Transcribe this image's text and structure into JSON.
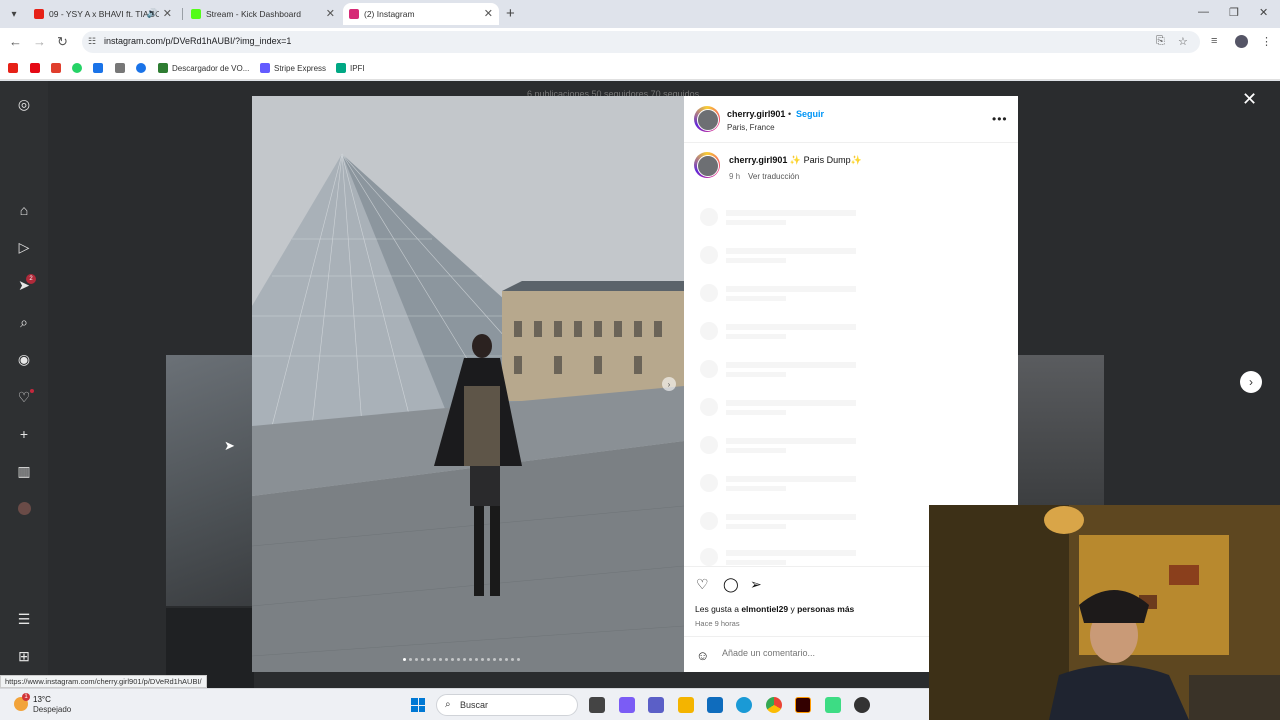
{
  "browser": {
    "tabs": [
      {
        "title": "09 - YSY A x BHAVI ft. TIAGO",
        "favicon_color": "#e62117",
        "active": false
      },
      {
        "title": "Stream - Kick Dashboard",
        "favicon_color": "#53fc18",
        "active": false
      },
      {
        "title": "(2) Instagram",
        "favicon_color": "#d62976",
        "active": true
      }
    ],
    "url": "instagram.com/p/DVeRd1hAUBI/?img_index=1",
    "bookmarks": [
      {
        "label": "",
        "color": "#e62117"
      },
      {
        "label": "",
        "color": "#e50914"
      },
      {
        "label": "",
        "color": "#e03e2d"
      },
      {
        "label": "",
        "color": "#25d366"
      },
      {
        "label": "",
        "color": "#1a73e8"
      },
      {
        "label": "",
        "color": "#555555"
      },
      {
        "label": "",
        "color": "#1a73e8"
      },
      {
        "label": "Descargador de VO...",
        "color": "#2e7d32"
      },
      {
        "label": "Stripe Express",
        "color": "#635bff"
      },
      {
        "label": "IPFI",
        "color": "#00a884"
      }
    ],
    "status_url": "https://www.instagram.com/cherry.girl901/p/DVeRd1hAUBI/"
  },
  "background_profile": {
    "stats": "6 publicaciones   50 seguidores   70 seguidos"
  },
  "sidebar": {
    "notification_count": "2"
  },
  "post": {
    "username": "cherry.girl901",
    "follow_label": "Seguir",
    "location": "Paris, France",
    "caption_text": "✨ Paris Dump✨",
    "time_short": "9 h",
    "translate_label": "Ver traducción",
    "likes_prefix": "Les gusta a",
    "likes_user": "elmontiel29",
    "likes_suffix": "y",
    "likes_more": "personas más",
    "time_long": "Hace 9 horas",
    "comment_placeholder": "Añade un comentario...",
    "carousel_count": 20,
    "carousel_index": 1
  },
  "taskbar": {
    "temperature": "13°C",
    "weather": "Despejado",
    "weather_badge": "1",
    "search_label": "Buscar",
    "apps": [
      {
        "name": "task-view",
        "color": "#444444"
      },
      {
        "name": "copilot",
        "color": "#7b5cf5"
      },
      {
        "name": "teams",
        "color": "#5b5fc7"
      },
      {
        "name": "file-explorer",
        "color": "#f4b400"
      },
      {
        "name": "outlook",
        "color": "#0f6cbd"
      },
      {
        "name": "edge",
        "color": "#1a9ad6"
      },
      {
        "name": "chrome",
        "color": "#34a853"
      },
      {
        "name": "illustrator",
        "color": "#8a2e0f"
      },
      {
        "name": "android-studio",
        "color": "#3ddc84"
      },
      {
        "name": "obs",
        "color": "#333333"
      }
    ]
  }
}
